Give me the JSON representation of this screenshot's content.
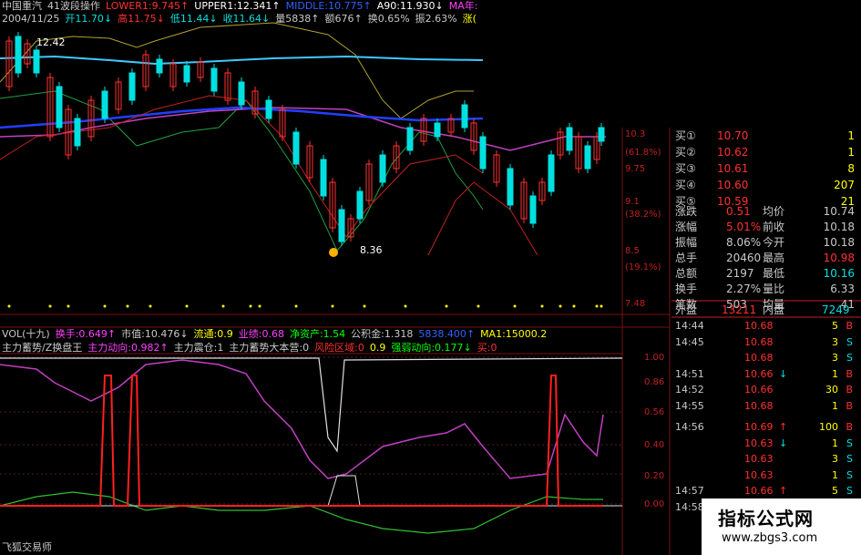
{
  "header": {
    "line1": [
      {
        "text": "中国重汽",
        "color": "#c8c8c8"
      },
      {
        "text": "41波段操作",
        "color": "#c8c8c8"
      },
      {
        "text": "LOWER1:9.745↑",
        "color": "#ff3030"
      },
      {
        "text": "UPPER1:12.341↑",
        "color": "#ffffff"
      },
      {
        "text": "MIDDLE:10.775↑",
        "color": "#3060ff"
      },
      {
        "text": "A90:11.930↓",
        "color": "#ffffff"
      },
      {
        "text": "MA年:",
        "color": "#ff40ff"
      }
    ],
    "line2": [
      {
        "text": "2004/11/25",
        "color": "#c8c8c8"
      },
      {
        "text": "开11.70↓",
        "color": "#00e0e0"
      },
      {
        "text": "高11.75↓",
        "color": "#ff3030"
      },
      {
        "text": "低11.44↓",
        "color": "#00e0e0"
      },
      {
        "text": "收11.64↓",
        "color": "#00e0e0"
      },
      {
        "text": "量5838↑",
        "color": "#c8c8c8"
      },
      {
        "text": "额676↑",
        "color": "#c8c8c8"
      },
      {
        "text": "换0.65%",
        "color": "#c8c8c8"
      },
      {
        "text": "振2.63%",
        "color": "#c8c8c8"
      },
      {
        "text": "涨(",
        "color": "#ffff00"
      }
    ]
  },
  "price_annotations": {
    "high_label": "12.42",
    "low_label": "8.36"
  },
  "price_axis": [
    "10.3",
    "(61.8%)",
    "9.75",
    "9.1",
    "(38.2%)",
    "8.5",
    "(19.1%)",
    "7.48"
  ],
  "vol_bar": [
    {
      "text": "VOL(十九)",
      "color": "#c8c8c8"
    },
    {
      "text": "换手:0.649↑",
      "color": "#ff40ff"
    },
    {
      "text": "市值:10.476↓",
      "color": "#c8c8c8"
    },
    {
      "text": "流通:0.9",
      "color": "#ffff00"
    },
    {
      "text": "业绩:0.68",
      "color": "#ff40ff"
    },
    {
      "text": "净资产:1.54",
      "color": "#00ff00"
    },
    {
      "text": "公积金:1.318",
      "color": "#c8c8c8"
    },
    {
      "text": "5838.400↑",
      "color": "#3060ff"
    },
    {
      "text": "MA1:15000.2",
      "color": "#ffff00"
    }
  ],
  "indicator_bar": [
    {
      "text": "主力蓄势/Z换盘王",
      "color": "#c8c8c8"
    },
    {
      "text": "主力动向:0.982↑",
      "color": "#ff40ff"
    },
    {
      "text": "主力震仓:1",
      "color": "#c8c8c8"
    },
    {
      "text": "主力蓄势大本营:0",
      "color": "#c8c8c8"
    },
    {
      "text": "风险区域:0",
      "color": "#ff3030"
    },
    {
      "text": "0.9",
      "color": "#ffff00"
    },
    {
      "text": "强弱动向:0.177↓",
      "color": "#00ff00"
    },
    {
      "text": "买:0",
      "color": "#ff3030"
    }
  ],
  "indicator_axis": [
    "1.00",
    "0.86",
    "0.56",
    "0.40",
    "0.20",
    "0.00"
  ],
  "footer_text": "飞狐交易师",
  "quotes": [
    {
      "label": "买①",
      "price": "10.70",
      "vol": "1"
    },
    {
      "label": "买②",
      "price": "10.62",
      "vol": "1"
    },
    {
      "label": "买③",
      "price": "10.61",
      "vol": "8"
    },
    {
      "label": "买④",
      "price": "10.60",
      "vol": "207"
    },
    {
      "label": "买⑤",
      "price": "10.59",
      "vol": "21"
    }
  ],
  "stats": [
    {
      "l1": "涨跌",
      "v1": "0.51",
      "l2": "均价",
      "v2": "10.74"
    },
    {
      "l1": "涨幅",
      "v1": "5.01%",
      "l2": "前收",
      "v2": "10.18"
    },
    {
      "l1": "振幅",
      "v1": "8.06%",
      "l2": "今开",
      "v2": "10.18"
    },
    {
      "l1": "总手",
      "v1": "20460",
      "l2": "最高",
      "v2": "10.98"
    },
    {
      "l1": "总额",
      "v1": "2197",
      "l2": "最低",
      "v2": "10.16"
    },
    {
      "l1": "换手",
      "v1": "2.27%",
      "l2": "量比",
      "v2": "6.33"
    },
    {
      "l1": "笔数",
      "v1": "503",
      "l2": "均量",
      "v2": "41"
    }
  ],
  "outer_inner": {
    "l1": "外盘",
    "v1": "13211",
    "l2": "内盘",
    "v2": "7249"
  },
  "trades": [
    {
      "time": "14:44",
      "price": "10.68",
      "arrow": "",
      "vol": "5",
      "side": "B"
    },
    {
      "time": "14:45",
      "price": "10.68",
      "arrow": "",
      "vol": "3",
      "side": "S"
    },
    {
      "time": "",
      "price": "10.68",
      "arrow": "",
      "vol": "3",
      "side": "S"
    },
    {
      "time": "14:51",
      "price": "10.66",
      "arrow": "↓",
      "vol": "1",
      "side": "B"
    },
    {
      "time": "14:52",
      "price": "10.66",
      "arrow": "",
      "vol": "30",
      "side": "B"
    },
    {
      "time": "14:55",
      "price": "10.68",
      "arrow": "",
      "vol": "1",
      "side": "B"
    },
    {
      "time": "14:56",
      "price": "10.69",
      "arrow": "↑",
      "vol": "100",
      "side": "B"
    },
    {
      "time": "",
      "price": "10.63",
      "arrow": "↓",
      "vol": "1",
      "side": "S"
    },
    {
      "time": "",
      "price": "10.63",
      "arrow": "",
      "vol": "3",
      "side": "S"
    },
    {
      "time": "",
      "price": "10.63",
      "arrow": "",
      "vol": "1",
      "side": "S"
    },
    {
      "time": "14:57",
      "price": "10.66",
      "arrow": "↑",
      "vol": "5",
      "side": "S"
    },
    {
      "time": "14:58",
      "price": "10.69",
      "arrow": "↑",
      "vol": "18",
      "side": "B"
    }
  ],
  "brand": {
    "name": "指标公式网",
    "url": "www.zbgs3.com"
  },
  "colors": {
    "up": "#ff3030",
    "down": "#00e0e0",
    "magenta": "#c040c0",
    "green": "#30c030",
    "yellow": "#ffff00"
  }
}
